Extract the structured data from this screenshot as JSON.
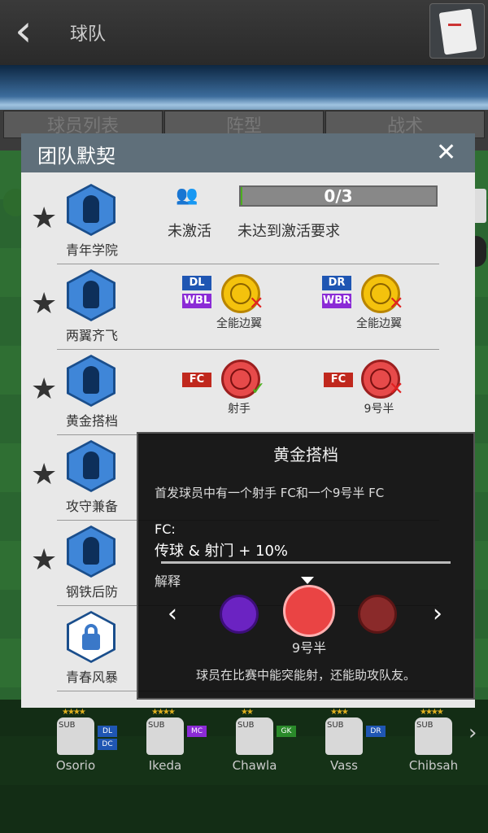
{
  "header": {
    "title": "球队"
  },
  "tabs": [
    "球员列表",
    "阵型",
    "战术"
  ],
  "modal": {
    "title": "团队默契",
    "close_label": "✕",
    "rows": [
      {
        "label": "青年学院",
        "status": "未激活",
        "requirement": "未达到激活要求",
        "progress_text": "0/3",
        "progress": 0
      },
      {
        "label": "两翼齐飞",
        "left": {
          "tags": [
            "DL",
            "WBL"
          ],
          "skill": "全能边翼",
          "met": false
        },
        "right": {
          "tags": [
            "DR",
            "WBR"
          ],
          "skill": "全能边翼",
          "met": false
        }
      },
      {
        "label": "黄金搭档",
        "left": {
          "tags": [
            "FC"
          ],
          "skill": "射手",
          "met": true
        },
        "right": {
          "tags": [
            "FC"
          ],
          "skill": "9号半",
          "met": false
        }
      },
      {
        "label": "攻守兼备"
      },
      {
        "label": "钢铁后防"
      },
      {
        "label": "青春风暴",
        "locked": true
      }
    ]
  },
  "tooltip": {
    "title": "黄金搭档",
    "description": "首发球员中有一个射手 FC和一个9号半 FC",
    "position": "FC:",
    "bonus": "传球 & 射门 + 10%",
    "explain_label": "解释",
    "selected_skill": "9号半",
    "footer": "球员在比赛中能突能射，还能助攻队友。"
  },
  "bench": [
    {
      "name": "Osorio",
      "stars": "★★★★",
      "positions": [
        "DL",
        "DC"
      ],
      "pos_colors": [
        "#1f56b3",
        "#1f56b3"
      ]
    },
    {
      "name": "Ikeda",
      "stars": "★★★★",
      "positions": [
        "MC"
      ],
      "pos_colors": [
        "#8b2bd6"
      ]
    },
    {
      "name": "Chawla",
      "stars": "★★",
      "positions": [
        "GK"
      ],
      "pos_colors": [
        "#2a8a2a"
      ]
    },
    {
      "name": "Vass",
      "stars": "★★★",
      "positions": [
        "DR"
      ],
      "pos_colors": [
        "#1f56b3"
      ]
    },
    {
      "name": "Chibsah",
      "stars": "★★★★",
      "positions": [],
      "pos_colors": []
    }
  ],
  "colors": {
    "header_bg": "#5f6f7a",
    "modal_bg": "#e8e8e8",
    "progress_bar": "#4caf1e"
  }
}
